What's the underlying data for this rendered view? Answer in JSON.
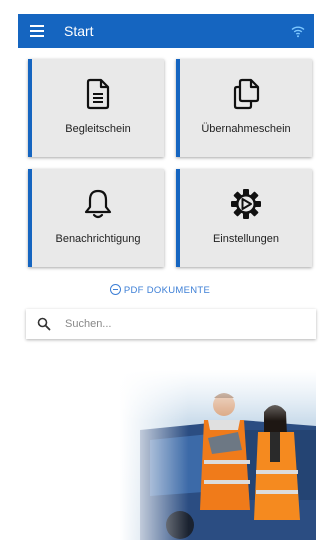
{
  "appbar": {
    "title": "Start",
    "bg": "#1565c0"
  },
  "tiles": [
    {
      "label": "Begleitschein",
      "icon": "document-icon"
    },
    {
      "label": "Übernahmeschein",
      "icon": "copy-documents-icon"
    },
    {
      "label": "Benachrichtigung",
      "icon": "bell-icon"
    },
    {
      "label": "Einstellungen",
      "icon": "gear-icon"
    }
  ],
  "pdf_link": {
    "label": "PDF DOKUMENTE",
    "icon": "minus-circle-icon"
  },
  "search": {
    "placeholder": "Suchen...",
    "value": "",
    "icon": "search-icon"
  },
  "colors": {
    "accent": "#1565c0",
    "tile_bg": "#e9e9e9",
    "link": "#3d7fd6"
  }
}
